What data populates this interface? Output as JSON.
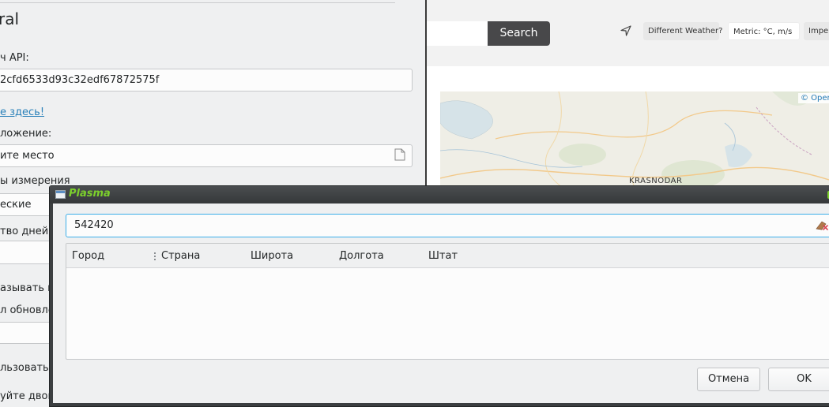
{
  "web": {
    "search_label": "Search",
    "different_weather_label": "Different Weather?",
    "metric_label": "Metric: °C, m/s",
    "imperial_label": "Imper",
    "map_credit": "© Oper",
    "map_city": "KRASNODAR"
  },
  "settings": {
    "title": "ral",
    "api_key_label": "ч API:",
    "api_key_value": "2cfd6533d93c32edf67872575f",
    "link_text": "е здесь!",
    "location_label": "ложение:",
    "location_placeholder": "ите место",
    "units_label": "ы измерения",
    "units_value": "еские",
    "days_label": "тво дней п",
    "show_label": "азывать п",
    "interval_label": "л обновле",
    "use_label": "льзовать",
    "double_label": "уйте двой"
  },
  "dialog": {
    "title": "Plasma",
    "search_value": "542420",
    "columns": [
      "Город",
      "Страна",
      "Широта",
      "Долгота",
      "Штат"
    ],
    "cancel_label": "Отмена",
    "ok_label": "OK"
  },
  "colors": {
    "accent": "#3daee9",
    "title_green": "#7cd02c",
    "search_button": "#48484a"
  }
}
